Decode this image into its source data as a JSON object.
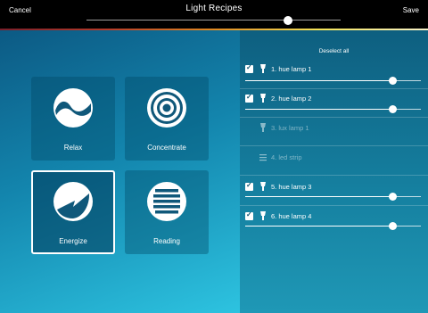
{
  "topbar": {
    "cancel_label": "Cancel",
    "title": "Light Recipes",
    "save_label": "Save",
    "brightness": 0.78
  },
  "recipes": [
    {
      "label": "Relax",
      "icon": "yin-yang-icon",
      "selected": false
    },
    {
      "label": "Concentrate",
      "icon": "concentric-circles-icon",
      "selected": false
    },
    {
      "label": "Energize",
      "icon": "lightning-bolt-icon",
      "selected": true
    },
    {
      "label": "Reading",
      "icon": "text-lines-icon",
      "selected": false
    }
  ],
  "panel": {
    "deselect_label": "Deselect all",
    "lights": [
      {
        "name": "1. hue lamp 1",
        "checked": true,
        "enabled": true,
        "brightness": 0.84,
        "icon": "lamp-icon"
      },
      {
        "name": "2. hue lamp 2",
        "checked": true,
        "enabled": true,
        "brightness": 0.84,
        "icon": "lamp-icon"
      },
      {
        "name": "3. lux lamp 1",
        "checked": false,
        "enabled": false,
        "icon": "lamp-icon"
      },
      {
        "name": "4. led strip",
        "checked": false,
        "enabled": false,
        "icon": "led-strip-icon"
      },
      {
        "name": "5. hue lamp 3",
        "checked": true,
        "enabled": true,
        "brightness": 0.84,
        "icon": "lamp-icon"
      },
      {
        "name": "6. hue lamp 4",
        "checked": true,
        "enabled": true,
        "brightness": 0.84,
        "icon": "lamp-icon"
      }
    ]
  },
  "colors": {
    "accent": "#157f9f",
    "tile_bg": "#0b4e6c",
    "tile_selected_border": "#ffffff"
  }
}
